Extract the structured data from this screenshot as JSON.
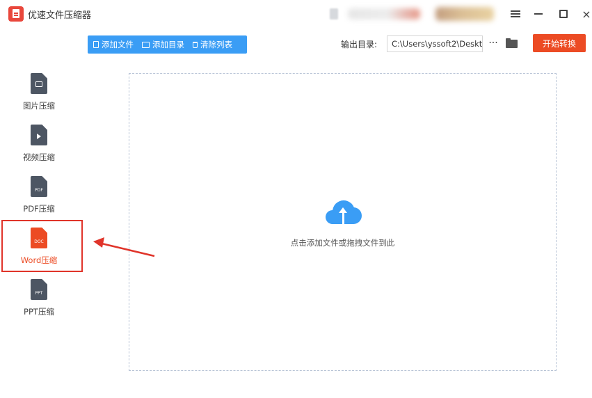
{
  "app": {
    "title": "优速文件压缩器"
  },
  "window_controls": {
    "menu": "menu-icon",
    "minimize": "minimize-icon",
    "maximize": "maximize-icon",
    "close": "×"
  },
  "toolbar": {
    "add_file": "添加文件",
    "add_folder": "添加目录",
    "clear_list": "清除列表",
    "color": "#3a9df5"
  },
  "output": {
    "label": "输出目录:",
    "path": "C:\\Users\\yssoft2\\Deskt",
    "more": "···",
    "start": "开始转换",
    "start_color": "#ec4b24"
  },
  "sidebar": {
    "items": [
      {
        "label": "图片压缩",
        "icon": "image-file-icon",
        "active": false
      },
      {
        "label": "视频压缩",
        "icon": "video-file-icon",
        "active": false
      },
      {
        "label": "PDF压缩",
        "icon": "pdf-file-icon",
        "badge": "PDF",
        "active": false
      },
      {
        "label": "Word压缩",
        "icon": "doc-file-icon",
        "badge": "DOC",
        "active": true
      },
      {
        "label": "PPT压缩",
        "icon": "ppt-file-icon",
        "badge": "PPT",
        "active": false
      }
    ],
    "active_color": "#ec4b24"
  },
  "dropzone": {
    "hint": "点击添加文件或拖拽文件到此",
    "icon": "cloud-upload-icon"
  }
}
